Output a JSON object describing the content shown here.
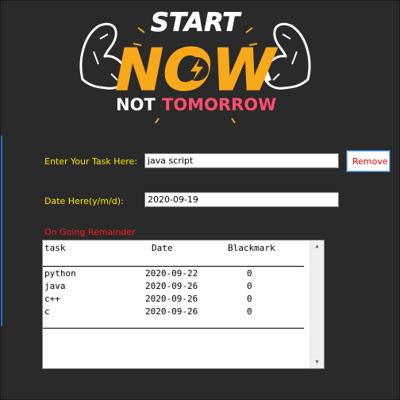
{
  "banner": {
    "line1": "START",
    "line2": "NOW",
    "line3a": "NOT",
    "line3b": "TOMORROW"
  },
  "form": {
    "task_label": "Enter Your Task Here:",
    "task_value": "java script",
    "remove_label": "Remove",
    "date_label": "Date Here(y/m/d):",
    "date_value": "2020-09-19"
  },
  "list": {
    "title": "On Going Remainder",
    "headers": {
      "task": "task",
      "date": "Date",
      "mark": "Blackmark"
    },
    "rows": [
      {
        "task": "python",
        "date": "2020-09-22",
        "mark": "0"
      },
      {
        "task": "java",
        "date": "2020-09-26",
        "mark": "0"
      },
      {
        "task": "c++",
        "date": "2020-09-26",
        "mark": "0"
      },
      {
        "task": "c",
        "date": "2020-09-26",
        "mark": "0"
      }
    ],
    "scroll_up_icon": "triangle-up-icon",
    "scroll_down_icon": "triangle-down-icon"
  },
  "colors": {
    "background": "#2a2a2a",
    "label_yellow": "#ffe600",
    "label_red": "#ff1a1a",
    "banner_orange": "#f7a81b",
    "banner_pink": "#ff4d6d"
  }
}
